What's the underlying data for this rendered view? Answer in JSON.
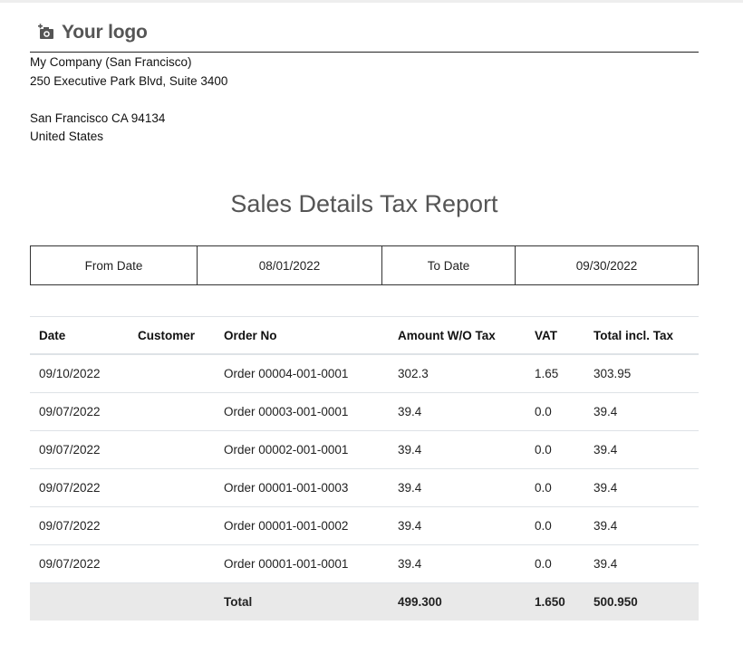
{
  "logo": {
    "text": "Your logo",
    "icon": "camera-icon"
  },
  "company": {
    "name": "My Company (San Francisco)",
    "street": "250 Executive Park Blvd, Suite 3400",
    "city_line": "San Francisco CA 94134",
    "country": "United States"
  },
  "report": {
    "title": "Sales Details Tax Report",
    "from_label": "From Date",
    "from_value": "08/01/2022",
    "to_label": "To Date",
    "to_value": "09/30/2022"
  },
  "table": {
    "headers": [
      "Date",
      "Customer",
      "Order No",
      "Amount W/O Tax",
      "VAT",
      "Total incl. Tax"
    ],
    "rows": [
      [
        "09/10/2022",
        "",
        "Order 00004-001-0001",
        "302.3",
        "1.65",
        "303.95"
      ],
      [
        "09/07/2022",
        "",
        "Order 00003-001-0001",
        "39.4",
        "0.0",
        "39.4"
      ],
      [
        "09/07/2022",
        "",
        "Order 00002-001-0001",
        "39.4",
        "0.0",
        "39.4"
      ],
      [
        "09/07/2022",
        "",
        "Order 00001-001-0003",
        "39.4",
        "0.0",
        "39.4"
      ],
      [
        "09/07/2022",
        "",
        "Order 00001-001-0002",
        "39.4",
        "0.0",
        "39.4"
      ],
      [
        "09/07/2022",
        "",
        "Order 00001-001-0001",
        "39.4",
        "0.0",
        "39.4"
      ]
    ],
    "total": [
      "",
      "",
      "Total",
      "499.300",
      "1.650",
      "500.950"
    ]
  }
}
